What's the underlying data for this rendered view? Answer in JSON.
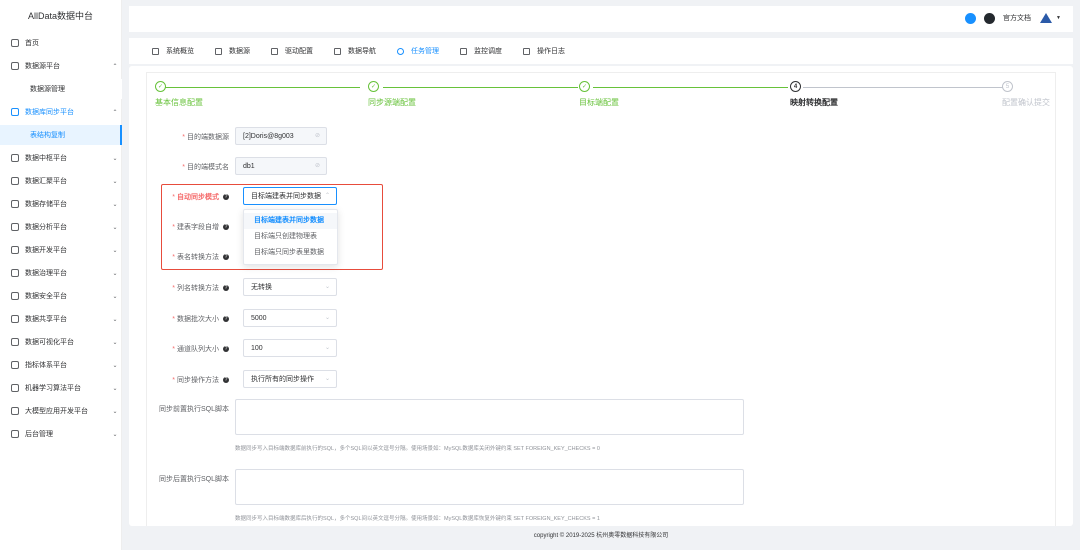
{
  "app": {
    "title": "AllData数据中台"
  },
  "sidebar": {
    "items": [
      {
        "label": "首页",
        "arrow": ""
      },
      {
        "label": "数据源平台",
        "arrow": "⌃"
      },
      {
        "label": "数据源管理",
        "arrow": ""
      },
      {
        "label": "数据库同步平台",
        "arrow": "⌃"
      },
      {
        "label": "表结构复制",
        "arrow": ""
      },
      {
        "label": "数据中枢平台",
        "arrow": "⌄"
      },
      {
        "label": "数据汇聚平台",
        "arrow": "⌄"
      },
      {
        "label": "数据存储平台",
        "arrow": "⌄"
      },
      {
        "label": "数据分析平台",
        "arrow": "⌄"
      },
      {
        "label": "数据开发平台",
        "arrow": "⌄"
      },
      {
        "label": "数据治理平台",
        "arrow": "⌄"
      },
      {
        "label": "数据安全平台",
        "arrow": "⌄"
      },
      {
        "label": "数据共享平台",
        "arrow": "⌄"
      },
      {
        "label": "数据可视化平台",
        "arrow": "⌄"
      },
      {
        "label": "指标体系平台",
        "arrow": "⌄"
      },
      {
        "label": "机器学习算法平台",
        "arrow": "⌄"
      },
      {
        "label": "大模型应用开发平台",
        "arrow": "⌄"
      },
      {
        "label": "后台管理",
        "arrow": "⌄"
      }
    ]
  },
  "header": {
    "docs": "官方文档"
  },
  "nav": {
    "tabs": [
      {
        "label": "系统概览"
      },
      {
        "label": "数据源"
      },
      {
        "label": "驱动配置"
      },
      {
        "label": "数据导航"
      },
      {
        "label": "任务管理"
      },
      {
        "label": "监控调度"
      },
      {
        "label": "操作日志"
      }
    ]
  },
  "steps": [
    {
      "num": "✓",
      "title": "基本信息配置"
    },
    {
      "num": "✓",
      "title": "同步源端配置"
    },
    {
      "num": "✓",
      "title": "目标端配置"
    },
    {
      "num": "4",
      "title": "映射转换配置"
    },
    {
      "num": "5",
      "title": "配置确认提交"
    }
  ],
  "form": {
    "target_ds_label": "目的端数据源",
    "target_ds_value": "[2]Doris@8g003",
    "target_schema_label": "目的端模式名",
    "target_schema_value": "db1",
    "auto_sync_label": "自动同步模式",
    "auto_sync_value": "目标端建表并同步数据",
    "auto_inc_label": "建表字段自增",
    "table_conv_label": "表名转换方法",
    "col_conv_label": "列名转换方法",
    "col_conv_value": "无转换",
    "batch_label": "数据批次大小",
    "batch_value": "5000",
    "queue_label": "通道队列大小",
    "queue_value": "100",
    "sync_op_label": "同步操作方法",
    "sync_op_value": "执行所有的同步操作",
    "pre_sql_label": "同步前置执行SQL脚本",
    "pre_sql_hint": "数据同步写入目标端数据库前执行的SQL，多个SQL间以英文逗号分隔。使用场景如：MySQL数据库关闭外键约束 SET FOREIGN_KEY_CHECKS = 0",
    "post_sql_label": "同步后置执行SQL脚本",
    "post_sql_hint": "数据同步写入目标端数据库后执行的SQL，多个SQL间以英文逗号分隔。使用场景如：MySQL数据库恢复外键约束 SET FOREIGN_KEY_CHECKS = 1"
  },
  "dropdown": {
    "options": [
      "目标端建表并同步数据",
      "目标端只创建物理表",
      "目标端只同步表里数据"
    ]
  },
  "footer": {
    "text": "copyright © 2019-2025 杭州奥零数据科技有限公司"
  }
}
